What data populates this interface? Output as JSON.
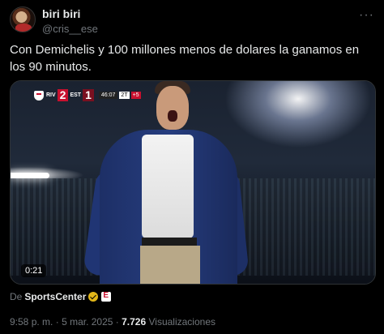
{
  "author": {
    "name": "biri biri",
    "handle": "@cris__ese"
  },
  "tweet": {
    "text": "Con Demichelis y 100 millones menos de dolares la ganamos en los 90 minutos."
  },
  "video": {
    "scorebug": {
      "home_team": "RIV",
      "home_score": "2",
      "away_score": "1",
      "away_team": "EST",
      "clock": "46:07",
      "extra": "2T",
      "added": "+5"
    },
    "duration": "0:21"
  },
  "source": {
    "prefix": "De",
    "name": "SportsCenter"
  },
  "meta": {
    "time": "9:58 p. m.",
    "sep1": "·",
    "date": "5 mar. 2025",
    "sep2": "·",
    "views": "7.726",
    "views_label": "Visualizaciones"
  },
  "icons": {
    "more": "more-icon",
    "verified": "verified-icon",
    "espn": "espn-icon",
    "club": "shield-icon"
  },
  "colors": {
    "background": "#000000",
    "text": "#e7e9ea",
    "muted": "#71767b",
    "verified_gold": "#e2b719",
    "score_red": "#c8102e"
  }
}
